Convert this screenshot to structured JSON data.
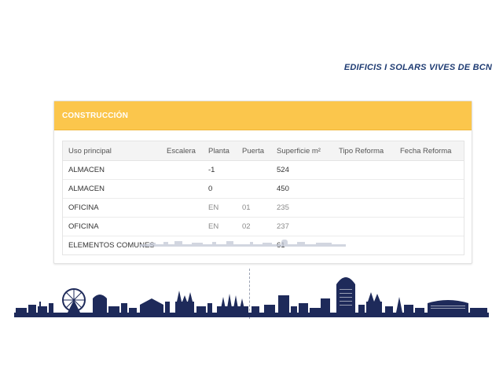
{
  "header": {
    "brand": "EDIFICIS I SOLARS VIVES DE BCN"
  },
  "panel": {
    "title": "CONSTRUCCIÓN",
    "columns": [
      "Uso principal",
      "Escalera",
      "Planta",
      "Puerta",
      "Superficie m²",
      "Tipo Reforma",
      "Fecha Reforma"
    ],
    "rows": [
      {
        "uso": "ALMACEN",
        "escalera": "",
        "planta": "-1",
        "puerta": "",
        "superficie": "524",
        "tipo": "",
        "fecha": ""
      },
      {
        "uso": "ALMACEN",
        "escalera": "",
        "planta": "0",
        "puerta": "",
        "superficie": "450",
        "tipo": "",
        "fecha": ""
      },
      {
        "uso": "OFICINA",
        "escalera": "",
        "planta": "EN",
        "puerta": "01",
        "superficie": "235",
        "tipo": "",
        "fecha": ""
      },
      {
        "uso": "OFICINA",
        "escalera": "",
        "planta": "EN",
        "puerta": "02",
        "superficie": "237",
        "tipo": "",
        "fecha": ""
      },
      {
        "uso": "ELEMENTOS COMUNES",
        "escalera": "",
        "planta": "",
        "puerta": "",
        "superficie": "61",
        "tipo": "",
        "fecha": ""
      }
    ]
  },
  "decor": {
    "skyline_color": "#1e2a5a",
    "accent_color": "#fbc64c"
  }
}
